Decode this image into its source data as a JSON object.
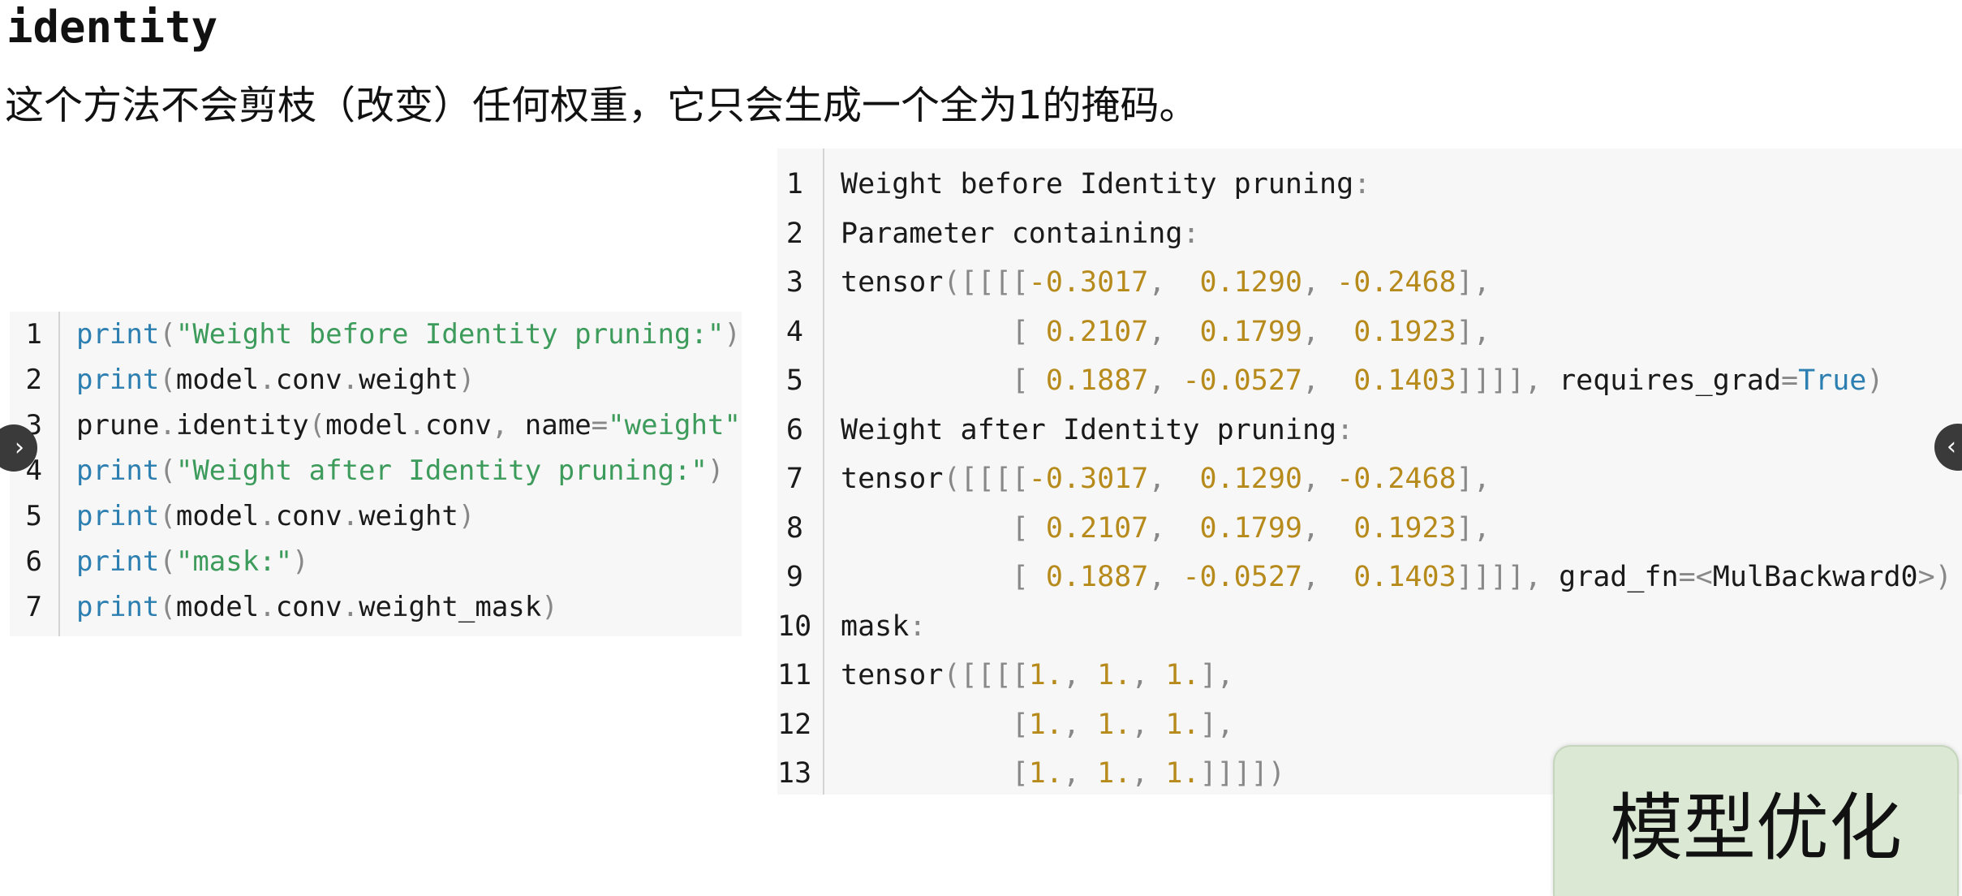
{
  "heading": "identity",
  "description": "这个方法不会剪枝（改变）任何权重，它只会生成一个全为1的掩码。",
  "left_code": {
    "lines": [
      {
        "n": "1",
        "tokens": [
          [
            "kw",
            "print"
          ],
          [
            "pun",
            "("
          ],
          [
            "str",
            "\"Weight before Identity pruning:\""
          ],
          [
            "pun",
            ")"
          ]
        ]
      },
      {
        "n": "2",
        "tokens": [
          [
            "kw",
            "print"
          ],
          [
            "pun",
            "("
          ],
          [
            "plain",
            "model"
          ],
          [
            "pun",
            "."
          ],
          [
            "plain",
            "conv"
          ],
          [
            "pun",
            "."
          ],
          [
            "plain",
            "weight"
          ],
          [
            "pun",
            ")"
          ]
        ]
      },
      {
        "n": "3",
        "tokens": [
          [
            "plain",
            "prune"
          ],
          [
            "pun",
            "."
          ],
          [
            "plain",
            "identity"
          ],
          [
            "pun",
            "("
          ],
          [
            "plain",
            "model"
          ],
          [
            "pun",
            "."
          ],
          [
            "plain",
            "conv"
          ],
          [
            "pun",
            ","
          ],
          [
            "plain",
            " name"
          ],
          [
            "pun",
            "="
          ],
          [
            "str",
            "\"weight\""
          ],
          [
            "pun",
            ")"
          ]
        ]
      },
      {
        "n": "4",
        "tokens": [
          [
            "kw",
            "print"
          ],
          [
            "pun",
            "("
          ],
          [
            "str",
            "\"Weight after Identity pruning:\""
          ],
          [
            "pun",
            ")"
          ]
        ]
      },
      {
        "n": "5",
        "tokens": [
          [
            "kw",
            "print"
          ],
          [
            "pun",
            "("
          ],
          [
            "plain",
            "model"
          ],
          [
            "pun",
            "."
          ],
          [
            "plain",
            "conv"
          ],
          [
            "pun",
            "."
          ],
          [
            "plain",
            "weight"
          ],
          [
            "pun",
            ")"
          ]
        ]
      },
      {
        "n": "6",
        "tokens": [
          [
            "kw",
            "print"
          ],
          [
            "pun",
            "("
          ],
          [
            "str",
            "\"mask:\""
          ],
          [
            "pun",
            ")"
          ]
        ]
      },
      {
        "n": "7",
        "tokens": [
          [
            "kw",
            "print"
          ],
          [
            "pun",
            "("
          ],
          [
            "plain",
            "model"
          ],
          [
            "pun",
            "."
          ],
          [
            "plain",
            "conv"
          ],
          [
            "pun",
            "."
          ],
          [
            "plain",
            "weight_mask"
          ],
          [
            "pun",
            ")"
          ]
        ]
      }
    ]
  },
  "right_code": {
    "lines": [
      {
        "n": "1",
        "tokens": [
          [
            "plain",
            "Weight before Identity pruning"
          ],
          [
            "pun",
            ":"
          ]
        ]
      },
      {
        "n": "2",
        "tokens": [
          [
            "plain",
            "Parameter containing"
          ],
          [
            "pun",
            ":"
          ]
        ]
      },
      {
        "n": "3",
        "tokens": [
          [
            "plain",
            "tensor"
          ],
          [
            "pun",
            "([[[["
          ],
          [
            "num",
            "-0.3017"
          ],
          [
            "pun",
            ",  "
          ],
          [
            "num",
            "0.1290"
          ],
          [
            "pun",
            ", "
          ],
          [
            "num",
            "-0.2468"
          ],
          [
            "pun",
            "],"
          ]
        ]
      },
      {
        "n": "4",
        "tokens": [
          [
            "plain",
            "          "
          ],
          [
            "pun",
            "[ "
          ],
          [
            "num",
            "0.2107"
          ],
          [
            "pun",
            ",  "
          ],
          [
            "num",
            "0.1799"
          ],
          [
            "pun",
            ",  "
          ],
          [
            "num",
            "0.1923"
          ],
          [
            "pun",
            "],"
          ]
        ]
      },
      {
        "n": "5",
        "tokens": [
          [
            "plain",
            "          "
          ],
          [
            "pun",
            "[ "
          ],
          [
            "num",
            "0.1887"
          ],
          [
            "pun",
            ", "
          ],
          [
            "num",
            "-0.0527"
          ],
          [
            "pun",
            ",  "
          ],
          [
            "num",
            "0.1403"
          ],
          [
            "pun",
            "]]]], "
          ],
          [
            "plain",
            "requires_grad"
          ],
          [
            "pun",
            "="
          ],
          [
            "kw",
            "True"
          ],
          [
            "pun",
            ")"
          ]
        ]
      },
      {
        "n": "6",
        "tokens": [
          [
            "plain",
            "Weight after Identity pruning"
          ],
          [
            "pun",
            ":"
          ]
        ]
      },
      {
        "n": "7",
        "tokens": [
          [
            "plain",
            "tensor"
          ],
          [
            "pun",
            "([[[["
          ],
          [
            "num",
            "-0.3017"
          ],
          [
            "pun",
            ",  "
          ],
          [
            "num",
            "0.1290"
          ],
          [
            "pun",
            ", "
          ],
          [
            "num",
            "-0.2468"
          ],
          [
            "pun",
            "],"
          ]
        ]
      },
      {
        "n": "8",
        "tokens": [
          [
            "plain",
            "          "
          ],
          [
            "pun",
            "[ "
          ],
          [
            "num",
            "0.2107"
          ],
          [
            "pun",
            ",  "
          ],
          [
            "num",
            "0.1799"
          ],
          [
            "pun",
            ",  "
          ],
          [
            "num",
            "0.1923"
          ],
          [
            "pun",
            "],"
          ]
        ]
      },
      {
        "n": "9",
        "tokens": [
          [
            "plain",
            "          "
          ],
          [
            "pun",
            "[ "
          ],
          [
            "num",
            "0.1887"
          ],
          [
            "pun",
            ", "
          ],
          [
            "num",
            "-0.0527"
          ],
          [
            "pun",
            ",  "
          ],
          [
            "num",
            "0.1403"
          ],
          [
            "pun",
            "]]]], "
          ],
          [
            "plain",
            "grad_fn"
          ],
          [
            "pun",
            "=<"
          ],
          [
            "plain",
            "MulBackward0"
          ],
          [
            "pun",
            ">)"
          ]
        ]
      },
      {
        "n": "10",
        "tokens": [
          [
            "plain",
            "mask"
          ],
          [
            "pun",
            ":"
          ]
        ]
      },
      {
        "n": "11",
        "tokens": [
          [
            "plain",
            "tensor"
          ],
          [
            "pun",
            "([[[["
          ],
          [
            "num",
            "1."
          ],
          [
            "pun",
            ", "
          ],
          [
            "num",
            "1."
          ],
          [
            "pun",
            ", "
          ],
          [
            "num",
            "1."
          ],
          [
            "pun",
            "],"
          ]
        ]
      },
      {
        "n": "12",
        "tokens": [
          [
            "plain",
            "          "
          ],
          [
            "pun",
            "["
          ],
          [
            "num",
            "1."
          ],
          [
            "pun",
            ", "
          ],
          [
            "num",
            "1."
          ],
          [
            "pun",
            ", "
          ],
          [
            "num",
            "1."
          ],
          [
            "pun",
            "],"
          ]
        ]
      },
      {
        "n": "13",
        "tokens": [
          [
            "plain",
            "          "
          ],
          [
            "pun",
            "["
          ],
          [
            "num",
            "1."
          ],
          [
            "pun",
            ", "
          ],
          [
            "num",
            "1."
          ],
          [
            "pun",
            ", "
          ],
          [
            "num",
            "1."
          ],
          [
            "pun",
            "]]]])"
          ]
        ]
      }
    ]
  },
  "nav": {
    "prev_icon": "chevron-right-icon",
    "prev_glyph": "›",
    "next_icon": "chevron-left-icon",
    "next_glyph": "‹"
  },
  "badge": "模型优化",
  "colors": {
    "keyword": "#2c7fb0",
    "string": "#3d9b5b",
    "number": "#b78a1c",
    "punctuation": "#888888",
    "badge_bg": "#dbe9d4"
  }
}
